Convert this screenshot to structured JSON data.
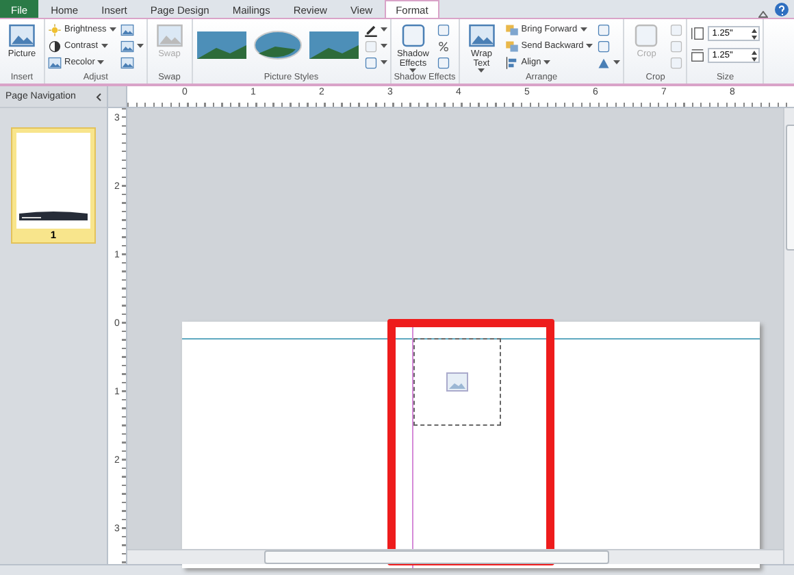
{
  "tabs": [
    {
      "label": "File",
      "kind": "file",
      "selected": false
    },
    {
      "label": "Home",
      "kind": "tab",
      "selected": false
    },
    {
      "label": "Insert",
      "kind": "tab",
      "selected": false
    },
    {
      "label": "Page Design",
      "kind": "tab",
      "selected": false
    },
    {
      "label": "Mailings",
      "kind": "tab",
      "selected": false
    },
    {
      "label": "Review",
      "kind": "tab",
      "selected": false
    },
    {
      "label": "View",
      "kind": "tab",
      "selected": false
    },
    {
      "label": "Format",
      "kind": "tab",
      "selected": true
    }
  ],
  "ribbon": {
    "groups": [
      {
        "label": "Insert",
        "columns": [
          [
            {
              "kind": "large",
              "label": "Picture",
              "disabled": false,
              "dropdown": false
            }
          ]
        ]
      },
      {
        "label": "Adjust",
        "columns": [
          [
            {
              "kind": "small",
              "label": "Brightness",
              "disabled": false,
              "dropdown": true
            },
            {
              "kind": "small",
              "label": "Contrast",
              "disabled": false,
              "dropdown": true
            },
            {
              "kind": "small",
              "label": "Recolor",
              "disabled": false,
              "dropdown": true
            }
          ],
          [
            {
              "kind": "icon",
              "disabled": false,
              "dropdown": false
            },
            {
              "kind": "icon",
              "disabled": false,
              "dropdown": true
            },
            {
              "kind": "icon",
              "disabled": false,
              "dropdown": false
            }
          ]
        ]
      },
      {
        "label": "Swap",
        "columns": [
          [
            {
              "kind": "large",
              "label": "Swap",
              "disabled": true,
              "dropdown": false
            }
          ]
        ]
      },
      {
        "label": "Picture Styles",
        "columns": [
          [
            {
              "kind": "thumb"
            }
          ],
          [
            {
              "kind": "thumb"
            }
          ],
          [
            {
              "kind": "thumb"
            }
          ],
          [
            {
              "kind": "icon",
              "disabled": false,
              "dropdown": true
            },
            {
              "kind": "icon",
              "disabled": true,
              "dropdown": true
            },
            {
              "kind": "icon",
              "disabled": false,
              "dropdown": true
            }
          ]
        ]
      },
      {
        "label": "Shadow Effects",
        "columns": [
          [
            {
              "kind": "large",
              "label": "Shadow Effects",
              "disabled": false,
              "dropdown": true
            }
          ],
          [
            {
              "kind": "icon",
              "disabled": false,
              "dropdown": false
            },
            {
              "kind": "icon",
              "disabled": false,
              "dropdown": false
            },
            {
              "kind": "icon",
              "disabled": false,
              "dropdown": false
            }
          ]
        ]
      },
      {
        "label": "Arrange",
        "columns": [
          [
            {
              "kind": "large",
              "label": "Wrap Text",
              "disabled": false,
              "dropdown": true
            }
          ],
          [
            {
              "kind": "small",
              "label": "Bring Forward",
              "disabled": false,
              "dropdown": true
            },
            {
              "kind": "small",
              "label": "Send Backward",
              "disabled": false,
              "dropdown": true
            },
            {
              "kind": "small",
              "label": "Align",
              "disabled": false,
              "dropdown": true
            }
          ],
          [
            {
              "kind": "icon",
              "disabled": false,
              "dropdown": false
            },
            {
              "kind": "icon",
              "disabled": false,
              "dropdown": false
            },
            {
              "kind": "icon",
              "disabled": false,
              "dropdown": true
            }
          ]
        ]
      },
      {
        "label": "Crop",
        "columns": [
          [
            {
              "kind": "large",
              "label": "Crop",
              "disabled": true,
              "dropdown": false
            }
          ],
          [
            {
              "kind": "icon",
              "disabled": true,
              "dropdown": false
            },
            {
              "kind": "icon",
              "disabled": true,
              "dropdown": false
            },
            {
              "kind": "icon",
              "disabled": true,
              "dropdown": false
            }
          ]
        ]
      },
      {
        "label": "Size",
        "columns": [
          [
            {
              "kind": "field",
              "value": "1.25\""
            },
            {
              "kind": "field",
              "value": "1.25\""
            }
          ]
        ]
      }
    ]
  },
  "navigation": {
    "title": "Page Navigation",
    "pages": [
      {
        "label": "1",
        "selected": true
      }
    ]
  },
  "rulers": {
    "horizontal": [
      "0",
      "1",
      "2",
      "3",
      "4",
      "5",
      "6",
      "7",
      "8"
    ],
    "vertical": [
      "3",
      "2",
      "1",
      "0",
      "1",
      "2",
      "3"
    ]
  }
}
